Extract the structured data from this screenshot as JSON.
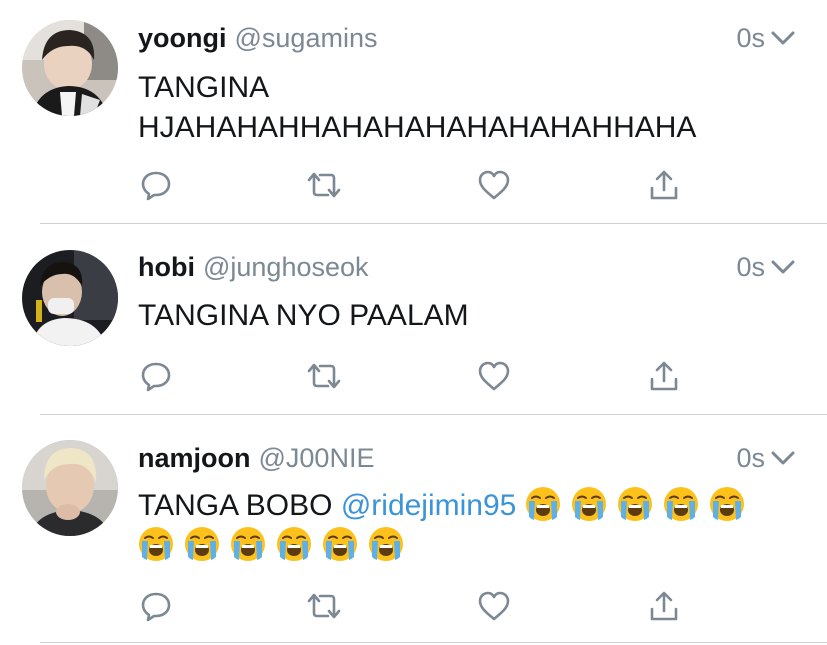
{
  "tweets": [
    {
      "name": "yoongi",
      "handle": "@sugamins",
      "time": "0s",
      "text_lines": [
        "TANGINA",
        "HJAHAHAHHAHAHAHAHAHAHAHHAHA"
      ],
      "avatar_icon": "avatar-photo-icon"
    },
    {
      "name": "hobi",
      "handle": "@junghoseok",
      "time": "0s",
      "text": "TANGINA NYO PAALAM",
      "avatar_icon": "avatar-photo-icon"
    },
    {
      "name": "namjoon",
      "handle": "@J00NIE",
      "time": "0s",
      "text_prefix": "TANGA BOBO ",
      "mention": "@ridejimin95",
      "emoji_name": "loudly-crying-face-icon",
      "emoji_count": 11,
      "avatar_icon": "avatar-photo-icon"
    }
  ],
  "action_icons": [
    "reply-icon",
    "retweet-icon",
    "like-icon",
    "share-icon"
  ],
  "colors": {
    "text": "#14171a",
    "secondary": "#7c8893",
    "mention": "#3b94d9",
    "icon": "#7c8893",
    "divider": "#cdd2d7"
  }
}
